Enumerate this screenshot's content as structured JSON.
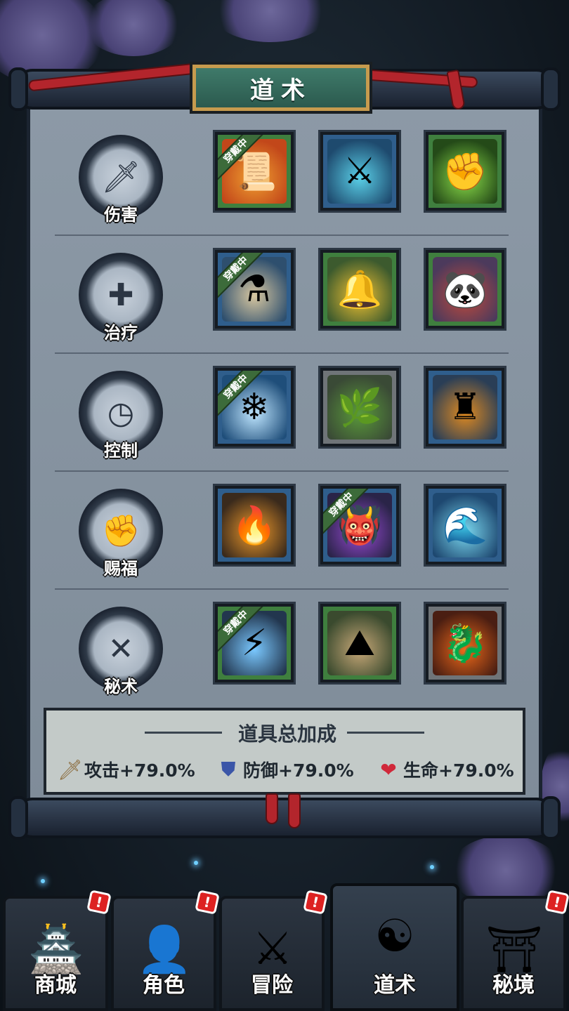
{
  "title": "道术",
  "equipped_tag": "穿戴中",
  "categories": [
    {
      "label": "伤害",
      "icon": "sword-icon",
      "skills": [
        {
          "frame": "green",
          "equipped": true,
          "icon": "fire-talisman-icon"
        },
        {
          "frame": "blue",
          "equipped": false,
          "icon": "flying-swords-icon"
        },
        {
          "frame": "green",
          "equipped": false,
          "icon": "green-fist-icon"
        }
      ]
    },
    {
      "label": "治疗",
      "icon": "heal-cross-icon",
      "skills": [
        {
          "frame": "blue",
          "equipped": true,
          "icon": "medicine-bottle-icon"
        },
        {
          "frame": "green",
          "equipped": false,
          "icon": "golden-bell-icon"
        },
        {
          "frame": "green",
          "equipped": false,
          "icon": "panda-monk-icon"
        }
      ]
    },
    {
      "label": "控制",
      "icon": "clock-icon",
      "skills": [
        {
          "frame": "blue",
          "equipped": true,
          "icon": "ice-crystal-icon"
        },
        {
          "frame": "gray",
          "equipped": false,
          "icon": "vines-icon"
        },
        {
          "frame": "blue",
          "equipped": false,
          "icon": "golden-pillar-icon"
        }
      ]
    },
    {
      "label": "赐福",
      "icon": "fist-icon",
      "skills": [
        {
          "frame": "blue",
          "equipped": false,
          "icon": "fire-spirit-icon"
        },
        {
          "frame": "blue",
          "equipped": true,
          "icon": "purple-beast-icon"
        },
        {
          "frame": "blue",
          "equipped": false,
          "icon": "water-spirit-icon"
        }
      ]
    },
    {
      "label": "秘术",
      "icon": "crossed-blades-icon",
      "skills": [
        {
          "frame": "green",
          "equipped": true,
          "icon": "thunder-cloud-icon"
        },
        {
          "frame": "green",
          "equipped": false,
          "icon": "earth-spike-icon"
        },
        {
          "frame": "gray",
          "equipped": false,
          "icon": "fire-dragon-icon"
        }
      ]
    }
  ],
  "bonus": {
    "title": "道具总加成",
    "attack": "攻击+79.0%",
    "defense": "防御+79.0%",
    "life": "生命+79.0%"
  },
  "nav": [
    {
      "label": "商城",
      "icon": "pagoda-coin-icon",
      "badge": "!",
      "active": false
    },
    {
      "label": "角色",
      "icon": "character-portrait-icon",
      "badge": "!",
      "active": false
    },
    {
      "label": "冒险",
      "icon": "crossed-swords-banner-icon",
      "badge": "!",
      "active": false
    },
    {
      "label": "道术",
      "icon": "yin-yang-icon",
      "badge": "",
      "active": true
    },
    {
      "label": "秘境",
      "icon": "shrine-portal-icon",
      "badge": "!",
      "active": false
    }
  ],
  "colors": {
    "frame_green": "#3f7f3e",
    "frame_blue": "#2f5e8c",
    "frame_gray": "#6f7478",
    "ribbon_red": "#b3252c",
    "plaque_green": "#2b5a4e",
    "plaque_gold": "#c69b4e"
  }
}
